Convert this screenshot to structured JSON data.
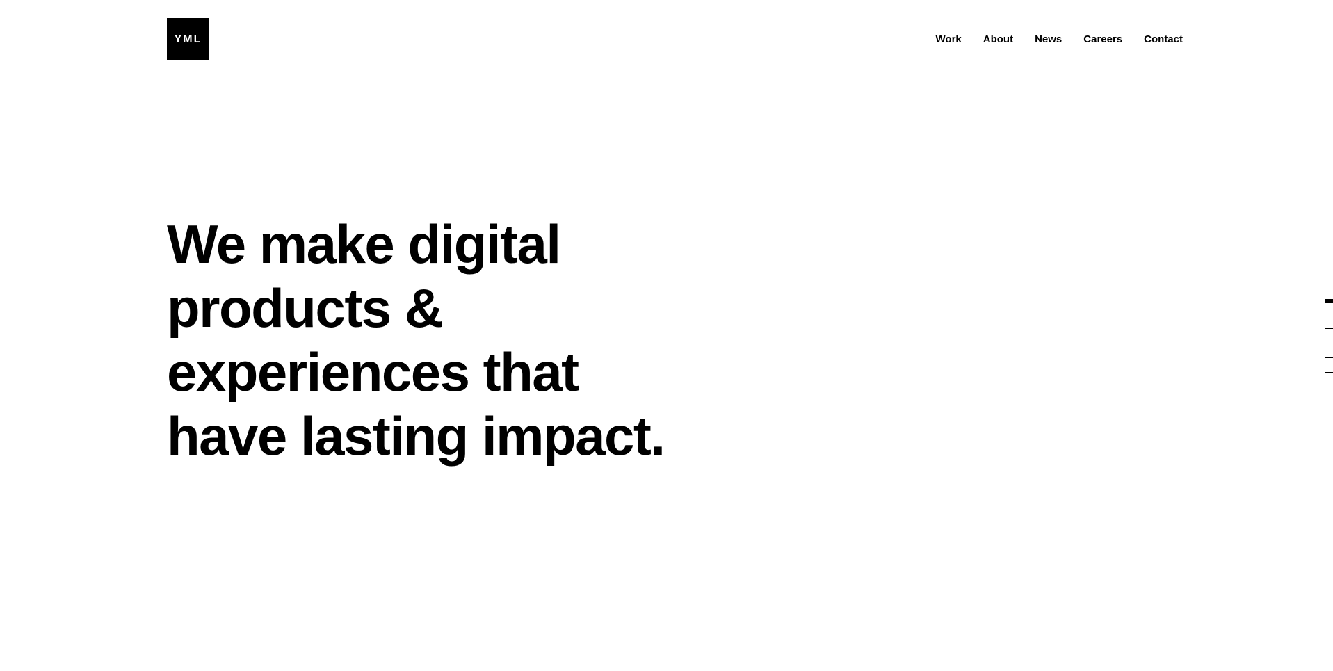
{
  "header": {
    "logo_text": "YML",
    "nav": [
      {
        "label": "Work"
      },
      {
        "label": "About"
      },
      {
        "label": "News"
      },
      {
        "label": "Careers"
      },
      {
        "label": "Contact"
      }
    ]
  },
  "hero": {
    "lines": [
      "We make digital",
      "products &",
      "experiences that",
      "have lasting impact."
    ]
  },
  "section_indicator": {
    "total_sections": 6,
    "active_index": 0
  }
}
